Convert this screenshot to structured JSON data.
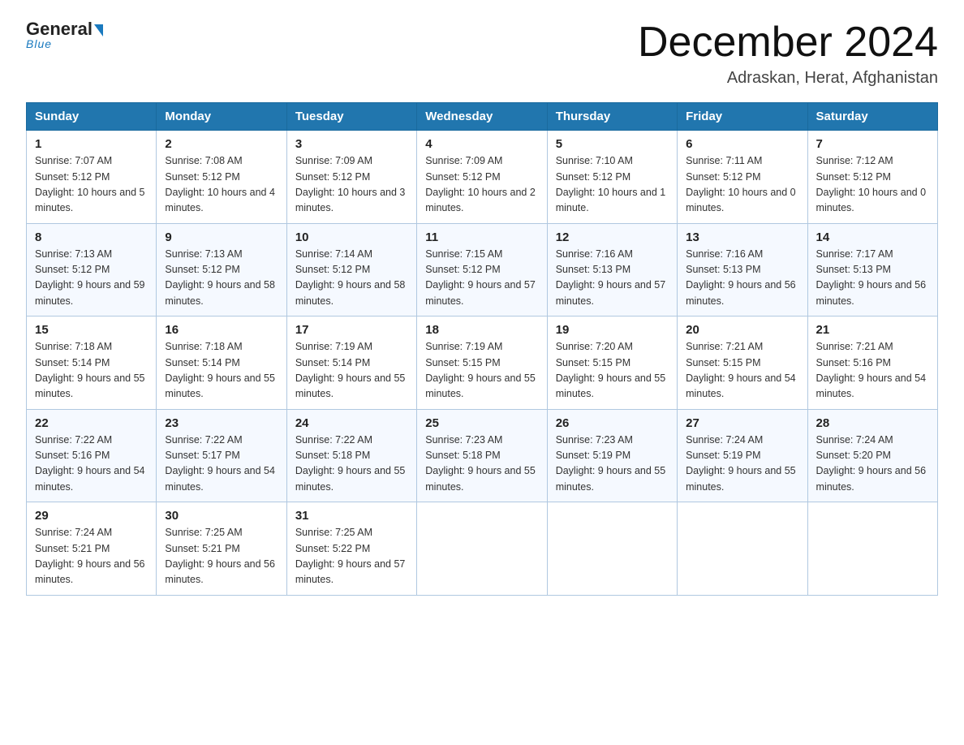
{
  "logo": {
    "name": "General",
    "name2": "Blue",
    "tagline": "Blue"
  },
  "title": "December 2024",
  "location": "Adraskan, Herat, Afghanistan",
  "days_header": [
    "Sunday",
    "Monday",
    "Tuesday",
    "Wednesday",
    "Thursday",
    "Friday",
    "Saturday"
  ],
  "weeks": [
    [
      {
        "num": "1",
        "sunrise": "7:07 AM",
        "sunset": "5:12 PM",
        "daylight": "10 hours and 5 minutes."
      },
      {
        "num": "2",
        "sunrise": "7:08 AM",
        "sunset": "5:12 PM",
        "daylight": "10 hours and 4 minutes."
      },
      {
        "num": "3",
        "sunrise": "7:09 AM",
        "sunset": "5:12 PM",
        "daylight": "10 hours and 3 minutes."
      },
      {
        "num": "4",
        "sunrise": "7:09 AM",
        "sunset": "5:12 PM",
        "daylight": "10 hours and 2 minutes."
      },
      {
        "num": "5",
        "sunrise": "7:10 AM",
        "sunset": "5:12 PM",
        "daylight": "10 hours and 1 minute."
      },
      {
        "num": "6",
        "sunrise": "7:11 AM",
        "sunset": "5:12 PM",
        "daylight": "10 hours and 0 minutes."
      },
      {
        "num": "7",
        "sunrise": "7:12 AM",
        "sunset": "5:12 PM",
        "daylight": "10 hours and 0 minutes."
      }
    ],
    [
      {
        "num": "8",
        "sunrise": "7:13 AM",
        "sunset": "5:12 PM",
        "daylight": "9 hours and 59 minutes."
      },
      {
        "num": "9",
        "sunrise": "7:13 AM",
        "sunset": "5:12 PM",
        "daylight": "9 hours and 58 minutes."
      },
      {
        "num": "10",
        "sunrise": "7:14 AM",
        "sunset": "5:12 PM",
        "daylight": "9 hours and 58 minutes."
      },
      {
        "num": "11",
        "sunrise": "7:15 AM",
        "sunset": "5:12 PM",
        "daylight": "9 hours and 57 minutes."
      },
      {
        "num": "12",
        "sunrise": "7:16 AM",
        "sunset": "5:13 PM",
        "daylight": "9 hours and 57 minutes."
      },
      {
        "num": "13",
        "sunrise": "7:16 AM",
        "sunset": "5:13 PM",
        "daylight": "9 hours and 56 minutes."
      },
      {
        "num": "14",
        "sunrise": "7:17 AM",
        "sunset": "5:13 PM",
        "daylight": "9 hours and 56 minutes."
      }
    ],
    [
      {
        "num": "15",
        "sunrise": "7:18 AM",
        "sunset": "5:14 PM",
        "daylight": "9 hours and 55 minutes."
      },
      {
        "num": "16",
        "sunrise": "7:18 AM",
        "sunset": "5:14 PM",
        "daylight": "9 hours and 55 minutes."
      },
      {
        "num": "17",
        "sunrise": "7:19 AM",
        "sunset": "5:14 PM",
        "daylight": "9 hours and 55 minutes."
      },
      {
        "num": "18",
        "sunrise": "7:19 AM",
        "sunset": "5:15 PM",
        "daylight": "9 hours and 55 minutes."
      },
      {
        "num": "19",
        "sunrise": "7:20 AM",
        "sunset": "5:15 PM",
        "daylight": "9 hours and 55 minutes."
      },
      {
        "num": "20",
        "sunrise": "7:21 AM",
        "sunset": "5:15 PM",
        "daylight": "9 hours and 54 minutes."
      },
      {
        "num": "21",
        "sunrise": "7:21 AM",
        "sunset": "5:16 PM",
        "daylight": "9 hours and 54 minutes."
      }
    ],
    [
      {
        "num": "22",
        "sunrise": "7:22 AM",
        "sunset": "5:16 PM",
        "daylight": "9 hours and 54 minutes."
      },
      {
        "num": "23",
        "sunrise": "7:22 AM",
        "sunset": "5:17 PM",
        "daylight": "9 hours and 54 minutes."
      },
      {
        "num": "24",
        "sunrise": "7:22 AM",
        "sunset": "5:18 PM",
        "daylight": "9 hours and 55 minutes."
      },
      {
        "num": "25",
        "sunrise": "7:23 AM",
        "sunset": "5:18 PM",
        "daylight": "9 hours and 55 minutes."
      },
      {
        "num": "26",
        "sunrise": "7:23 AM",
        "sunset": "5:19 PM",
        "daylight": "9 hours and 55 minutes."
      },
      {
        "num": "27",
        "sunrise": "7:24 AM",
        "sunset": "5:19 PM",
        "daylight": "9 hours and 55 minutes."
      },
      {
        "num": "28",
        "sunrise": "7:24 AM",
        "sunset": "5:20 PM",
        "daylight": "9 hours and 56 minutes."
      }
    ],
    [
      {
        "num": "29",
        "sunrise": "7:24 AM",
        "sunset": "5:21 PM",
        "daylight": "9 hours and 56 minutes."
      },
      {
        "num": "30",
        "sunrise": "7:25 AM",
        "sunset": "5:21 PM",
        "daylight": "9 hours and 56 minutes."
      },
      {
        "num": "31",
        "sunrise": "7:25 AM",
        "sunset": "5:22 PM",
        "daylight": "9 hours and 57 minutes."
      },
      null,
      null,
      null,
      null
    ]
  ],
  "labels": {
    "sunrise": "Sunrise:",
    "sunset": "Sunset:",
    "daylight": "Daylight:"
  }
}
